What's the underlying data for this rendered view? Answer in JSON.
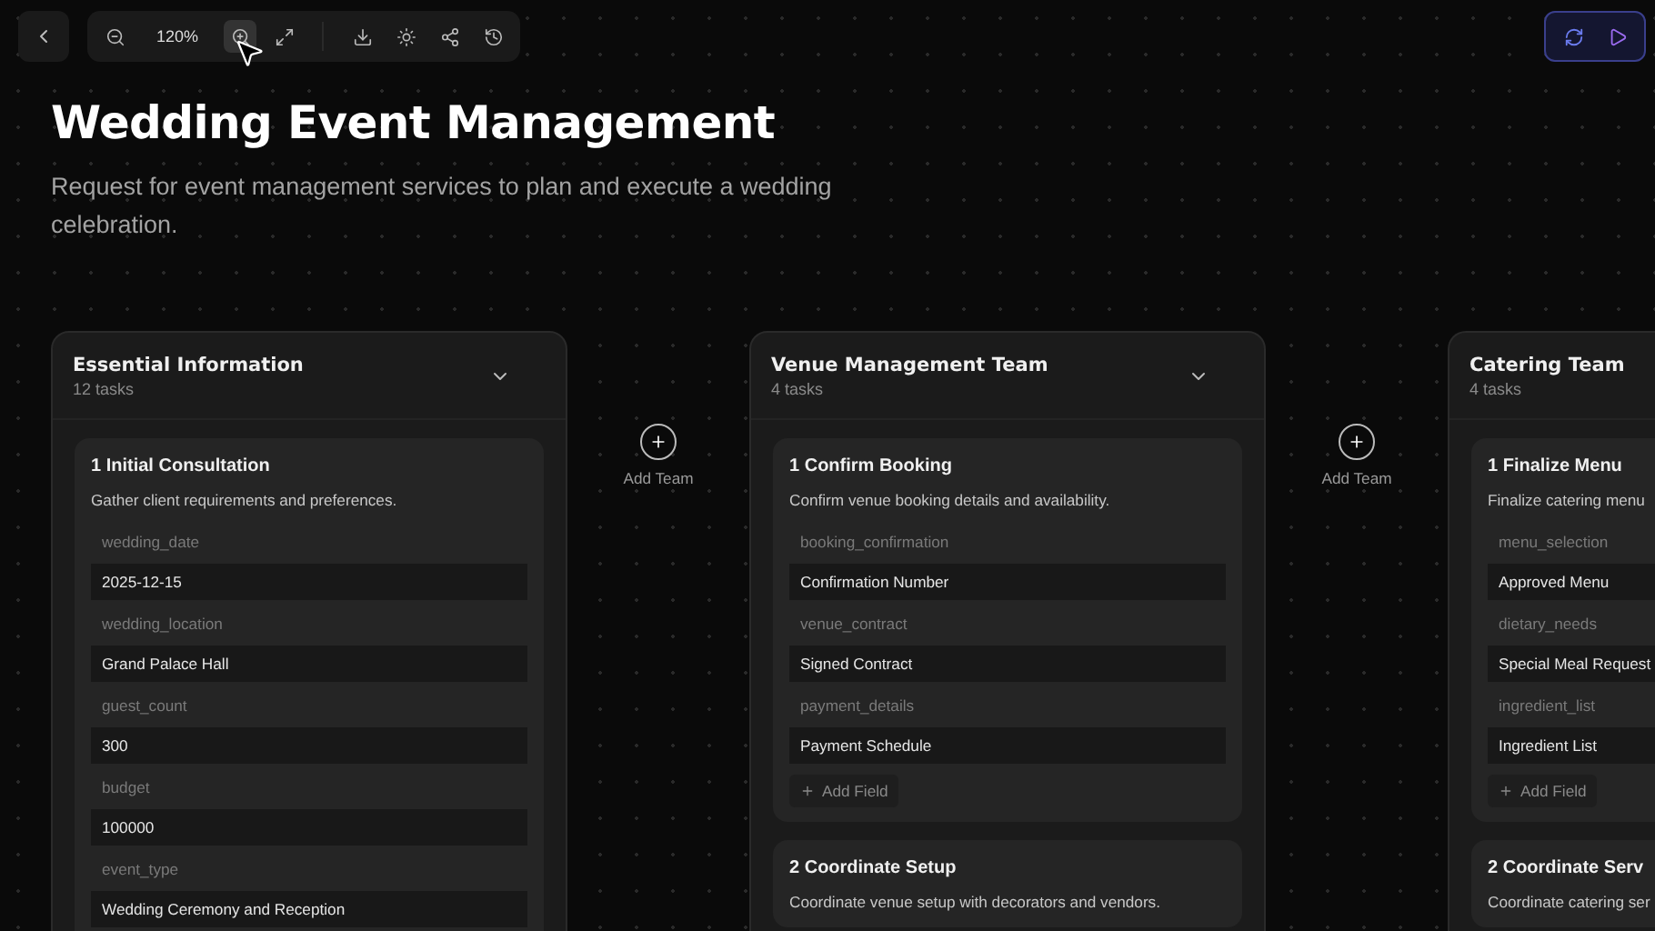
{
  "toolbar": {
    "back": {
      "kind": "back"
    },
    "tools": [
      {
        "kind": "zoom-out",
        "highlighted": false
      },
      {
        "kind": "zoom-level",
        "text": "120%",
        "highlighted": false
      },
      {
        "kind": "zoom-in",
        "highlighted": true
      },
      {
        "kind": "fit",
        "highlighted": false
      },
      {
        "kind": "divider",
        "highlighted": false
      },
      {
        "kind": "download",
        "highlighted": false
      },
      {
        "kind": "theme",
        "highlighted": false
      },
      {
        "kind": "share",
        "highlighted": false
      },
      {
        "kind": "history",
        "highlighted": false
      }
    ],
    "actions": [
      {
        "kind": "refresh"
      },
      {
        "kind": "run"
      }
    ]
  },
  "title": "Wedding Event Management",
  "subtitle": "Request for event management services to plan and execute a wedding celebration.",
  "teams": [
    {
      "name": "Essential Information",
      "task_count": "12 tasks",
      "expanded": true,
      "add_team": "Add Team",
      "tasks": [
        {
          "number": "1",
          "title": "Initial Consultation",
          "description": "Gather client requirements and preferences.",
          "fields": [
            {
              "label": "wedding_date",
              "value": "2025-12-15"
            },
            {
              "label": "wedding_location",
              "value": "Grand Palace Hall"
            },
            {
              "label": "guest_count",
              "value": "300"
            },
            {
              "label": "budget",
              "value": "100000"
            },
            {
              "label": "event_type",
              "value": "Wedding Ceremony and Reception"
            }
          ]
        }
      ]
    },
    {
      "name": "Venue Management Team",
      "task_count": "4 tasks",
      "expanded": true,
      "add_team": "Add Team",
      "tasks": [
        {
          "number": "1",
          "title": "Confirm Booking",
          "description": "Confirm venue booking details and availability.",
          "fields": [
            {
              "label": "booking_confirmation",
              "value": "Confirmation Number"
            },
            {
              "label": "venue_contract",
              "value": "Signed Contract"
            },
            {
              "label": "payment_details",
              "value": "Payment Schedule"
            }
          ],
          "add_field": "Add Field"
        },
        {
          "number": "2",
          "title": "Coordinate Setup",
          "description": "Coordinate venue setup with decorators and vendors."
        }
      ]
    },
    {
      "name": "Catering Team",
      "task_count": "4 tasks",
      "tasks": [
        {
          "number": "1",
          "title": "Finalize Menu",
          "description": "Finalize catering menu",
          "fields": [
            {
              "label": "menu_selection",
              "value": "Approved Menu"
            },
            {
              "label": "dietary_needs",
              "value": "Special Meal Request"
            },
            {
              "label": "ingredient_list",
              "value": "Ingredient List"
            }
          ],
          "add_field": "Add Field"
        },
        {
          "number": "2",
          "title": "Coordinate Serv",
          "description": "Coordinate catering ser"
        }
      ]
    }
  ]
}
